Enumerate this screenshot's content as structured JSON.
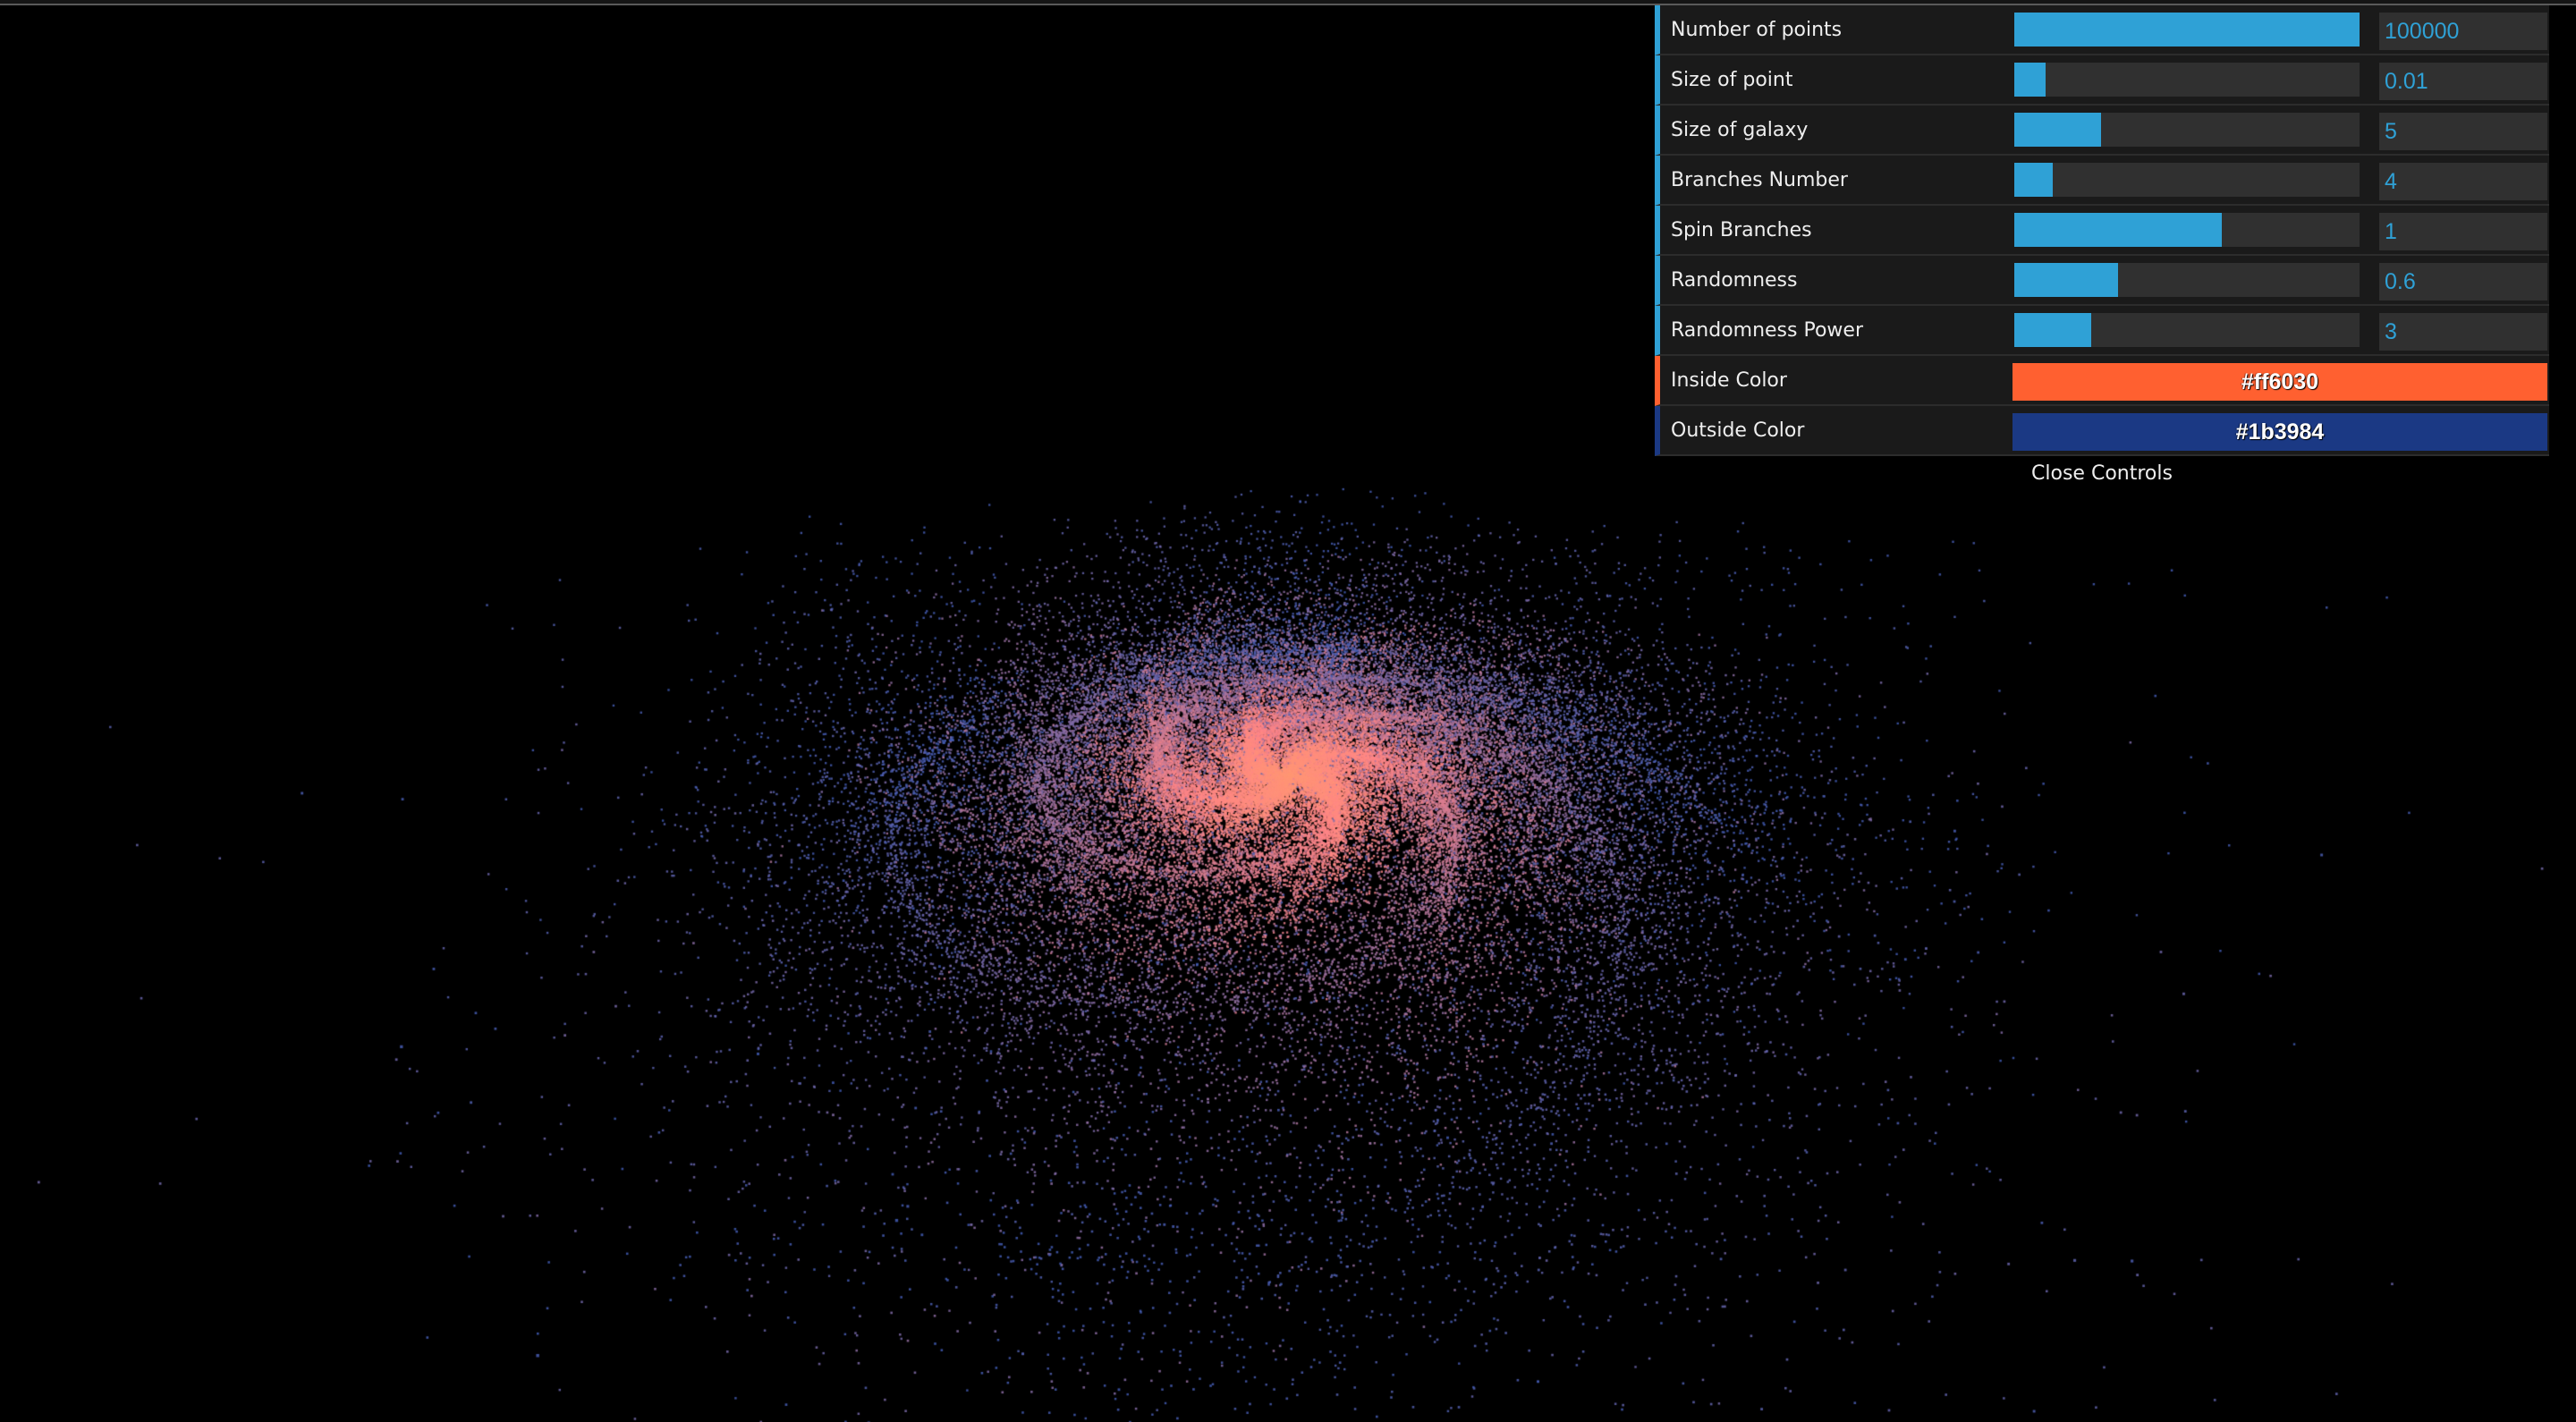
{
  "canvas": {
    "name": "galaxy-particle-view",
    "branches": 4,
    "spin": 1,
    "randomness": 0.6,
    "randomness_power": 3,
    "inside_color": "#ff6030",
    "outside_color": "#1b3984"
  },
  "gui": {
    "accent_color": "#2fa1d6",
    "controls": [
      {
        "type": "slider",
        "label": "Number of points",
        "value": "100000",
        "fraction": 1.0
      },
      {
        "type": "slider",
        "label": "Size of point",
        "value": "0.01",
        "fraction": 0.09
      },
      {
        "type": "slider",
        "label": "Size of galaxy",
        "value": "5",
        "fraction": 0.25
      },
      {
        "type": "slider",
        "label": "Branches Number",
        "value": "4",
        "fraction": 0.111
      },
      {
        "type": "slider",
        "label": "Spin Branches",
        "value": "1",
        "fraction": 0.6
      },
      {
        "type": "slider",
        "label": "Randomness",
        "value": "0.6",
        "fraction": 0.3
      },
      {
        "type": "slider",
        "label": "Randomness Power",
        "value": "3",
        "fraction": 0.222
      },
      {
        "type": "color",
        "label": "Inside Color",
        "value": "#ff6030"
      },
      {
        "type": "color",
        "label": "Outside Color",
        "value": "#1b3984"
      }
    ],
    "close_label": "Close Controls"
  }
}
